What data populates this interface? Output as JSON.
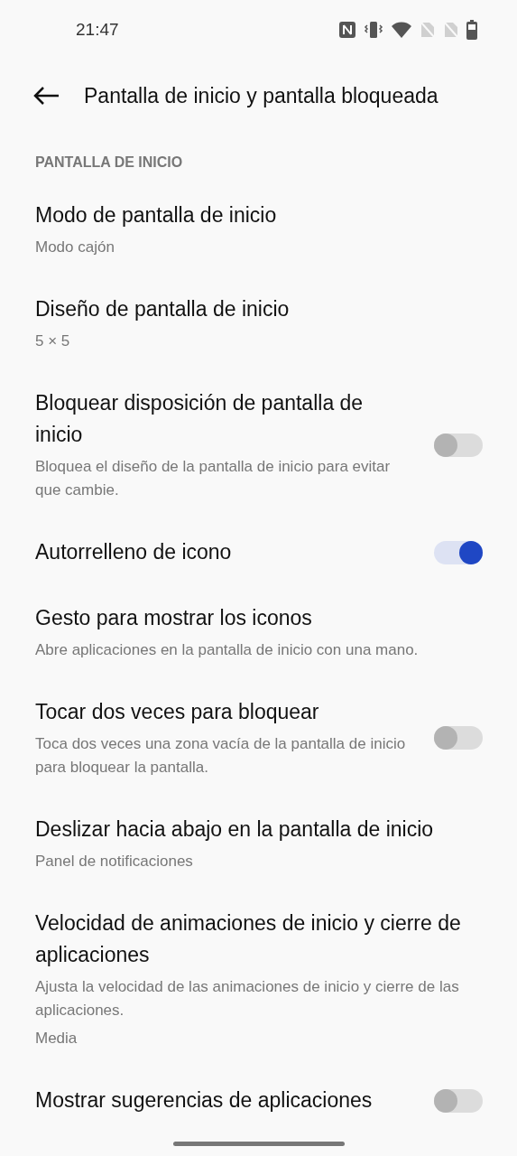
{
  "status_bar": {
    "time": "21:47"
  },
  "header": {
    "title": "Pantalla de inicio y pantalla bloqueada"
  },
  "section": {
    "label": "PANTALLA DE INICIO"
  },
  "items": [
    {
      "kind": "link",
      "title": "Modo de pantalla de inicio",
      "subtitle": "Modo cajón"
    },
    {
      "kind": "link",
      "title": "Diseño de pantalla de inicio",
      "subtitle": "5 × 5"
    },
    {
      "kind": "toggle",
      "title": "Bloquear disposición de pantalla de inicio",
      "subtitle": "Bloquea el diseño de la pantalla de inicio para evitar que cambie.",
      "on": false
    },
    {
      "kind": "toggle",
      "title": "Autorrelleno de icono",
      "on": true
    },
    {
      "kind": "link",
      "title": "Gesto para mostrar los iconos",
      "subtitle": "Abre aplicaciones en la pantalla de inicio con una mano."
    },
    {
      "kind": "toggle",
      "title": "Tocar dos veces para bloquear",
      "subtitle": "Toca dos veces una zona vacía de la pantalla de inicio para bloquear la pantalla.",
      "on": false
    },
    {
      "kind": "link",
      "title": "Deslizar hacia abajo en la pantalla de inicio",
      "subtitle": "Panel de notificaciones"
    },
    {
      "kind": "link",
      "title": "Velocidad de animaciones de inicio y cierre de aplicaciones",
      "subtitle": "Ajusta la velocidad de las animaciones de inicio y cierre de las aplicaciones.",
      "value": "Media"
    },
    {
      "kind": "toggle",
      "title": "Mostrar sugerencias de aplicaciones",
      "on": false
    }
  ]
}
